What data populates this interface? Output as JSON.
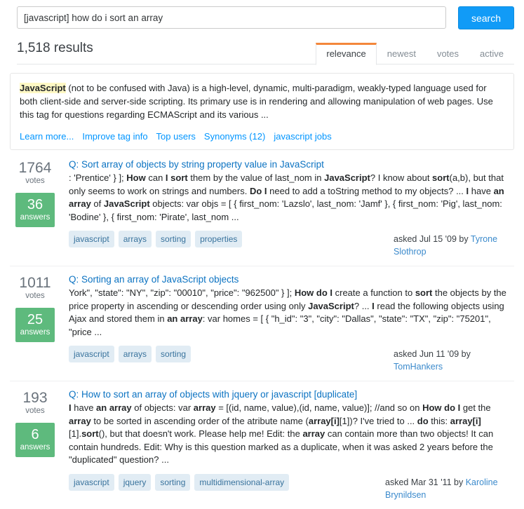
{
  "search": {
    "query": "[javascript] how do i sort an array",
    "placeholder": "search",
    "button_label": "search"
  },
  "results_header": {
    "count_label": "1,518 results",
    "tabs": [
      {
        "label": "relevance",
        "active": true
      },
      {
        "label": "newest",
        "active": false
      },
      {
        "label": "votes",
        "active": false
      },
      {
        "label": "active",
        "active": false
      }
    ]
  },
  "tag_info": {
    "highlight": "JavaScript",
    "description": " (not to be confused with Java) is a high-level, dynamic, multi-paradigm, weakly-typed language used for both client-side and server-side scripting. Its primary use is in rendering and allowing manipulation of web pages. Use this tag for questions regarding ECMAScript and its various ...",
    "links": [
      "Learn more...",
      "Improve tag info",
      "Top users",
      "Synonyms (12)",
      "javascript jobs"
    ]
  },
  "colors": {
    "accent_blue": "#119bf7",
    "link_blue": "#0095ff",
    "title_blue": "#0c73c2",
    "answers_green": "#5eba7d",
    "tag_bg": "#e1ecf4",
    "tag_text": "#39739d",
    "active_tab_border": "#f4873b",
    "highlight_yellow": "#fff8c4"
  },
  "results": [
    {
      "votes": "1764",
      "votes_label": "votes",
      "answers": "36",
      "answers_label": "answers",
      "title": "Q: Sort array of objects by string property value in JavaScript",
      "excerpt_html": ": 'Prentice' } ]; <b>How</b> can <b>I sort</b> them by the value of last_nom in <b>JavaScript</b>? I know about <b>sort</b>(a,b), but that only seems to work on strings and numbers. <b>Do I</b> need to add a toString method to my objects? ... <b>I</b> have <b>an array</b> of <b>JavaScript</b> objects: var objs = [ { first_nom: 'Lazslo', last_nom: 'Jamf' }, { first_nom: 'Pig', last_nom: 'Bodine' }, { first_nom: 'Pirate', last_nom ...",
      "tags": [
        "javascript",
        "arrays",
        "sorting",
        "properties"
      ],
      "asked_prefix": "asked Jul 15 '09 by",
      "asked_user": "Tyrone Slothrop"
    },
    {
      "votes": "1011",
      "votes_label": "votes",
      "answers": "25",
      "answers_label": "answers",
      "title": "Q: Sorting an array of JavaScript objects",
      "excerpt_html": "York\", \"state\": \"NY\", \"zip\": \"00010\", \"price\": \"962500\" } ]; <b>How do I</b> create a function to <b>sort</b> the objects by the price property in ascending or descending order using only <b>JavaScript</b>? ... <b>I</b> read the following objects using Ajax and stored them in <b>an array</b>: var homes = [ { \"h_id\": \"3\", \"city\": \"Dallas\", \"state\": \"TX\", \"zip\": \"75201\", \"price ...",
      "tags": [
        "javascript",
        "arrays",
        "sorting"
      ],
      "asked_prefix": "asked Jun 11 '09 by",
      "asked_user": "TomHankers"
    },
    {
      "votes": "193",
      "votes_label": "votes",
      "answers": "6",
      "answers_label": "answers",
      "title": "Q: How to sort an array of objects with jquery or javascript [duplicate]",
      "excerpt_html": "<b>I</b> have <b>an array</b> of objects: var <b>array</b> = [(id, name, value),(id, name, value)]; //and so on <b>How do I</b> get the <b>array</b> to be sorted in ascending order of the atribute name (<b>array[i]</b>[1])? I've tried to ... <b>do</b> this: <b>array[i]</b>[1].<b>sort</b>(), but that doesn't work. Please help me! Edit: the <b>array</b> can contain more than two objects! It can contain hundreds. Edit: Why is this question marked as a duplicate, when it was asked 2 years before the \"duplicated\" question? ...",
      "tags": [
        "javascript",
        "jquery",
        "sorting",
        "multidimensional-array"
      ],
      "asked_prefix": "asked Mar 31 '11 by",
      "asked_user": "Karoline Brynildsen"
    }
  ]
}
